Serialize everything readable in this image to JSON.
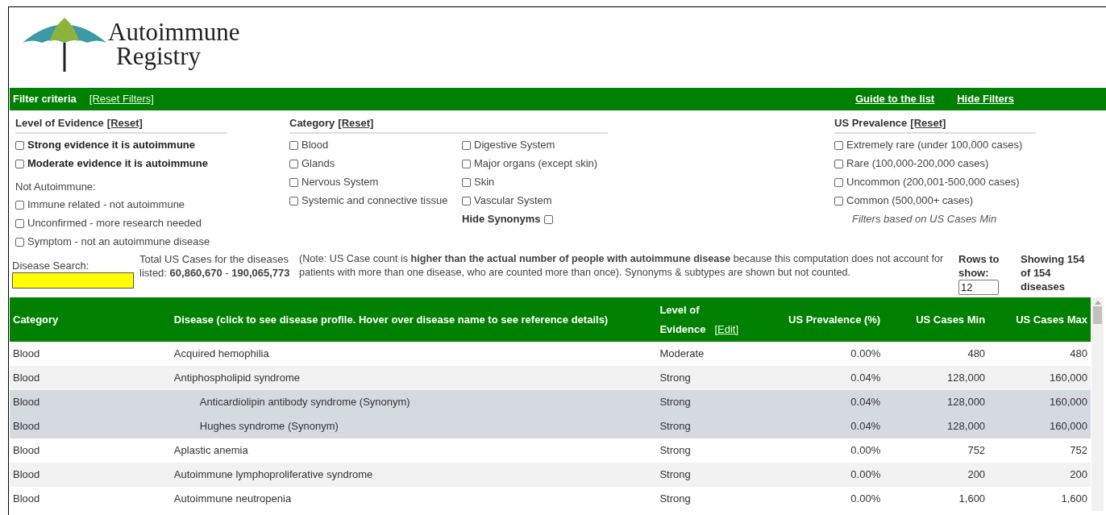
{
  "logo": {
    "lines": [
      "Autoimmune",
      "Registry"
    ]
  },
  "filter_bar": {
    "title": "Filter criteria",
    "reset": "[Reset Filters]",
    "links": [
      "Guide to the list",
      "Hide Filters"
    ]
  },
  "evidence": {
    "title": "Level of Evidence",
    "reset": "[Reset]",
    "options": [
      {
        "label": "Strong evidence it is autoimmune",
        "checked": false,
        "bold": true
      },
      {
        "label": "Moderate evidence it is autoimmune",
        "checked": false,
        "bold": true
      }
    ],
    "subheading": "Not Autoimmune:",
    "other_options": [
      {
        "label": "Immune related - not autoimmune",
        "checked": false
      },
      {
        "label": "Unconfirmed - more research needed",
        "checked": false
      },
      {
        "label": "Symptom - not an autoimmune disease",
        "checked": false
      }
    ]
  },
  "category": {
    "title": "Category",
    "reset": "[Reset]",
    "options": [
      {
        "label": "Blood",
        "checked": false
      },
      {
        "label": "Digestive System",
        "checked": false
      },
      {
        "label": "Glands",
        "checked": false
      },
      {
        "label": "Major organs (except skin)",
        "checked": false
      },
      {
        "label": "Nervous System",
        "checked": false
      },
      {
        "label": "Skin",
        "checked": false
      },
      {
        "label": "Systemic and connective tissue",
        "checked": false
      },
      {
        "label": "Vascular System",
        "checked": false
      }
    ],
    "hide_synonyms": {
      "label": "Hide Synonyms",
      "checked": false
    }
  },
  "prevalence": {
    "title": "US Prevalence",
    "reset": "[Reset]",
    "options": [
      {
        "label": "Extremely rare (under 100,000 cases)",
        "checked": false
      },
      {
        "label": "Rare (100,000-200,000 cases)",
        "checked": false
      },
      {
        "label": "Uncommon (200,001-500,000 cases)",
        "checked": false
      },
      {
        "label": "Common (500,000+ cases)",
        "checked": false
      }
    ],
    "note": "Filters based on US Cases Min"
  },
  "search": {
    "label": "Disease Search:"
  },
  "total": "Total US Cases for the diseases listed: **60,860,670** - **190,065,773**",
  "note": "(Note: US Case count is **higher than the actual number of people with autoimmune disease** because this computation does not account for patients with more than one disease, who are counted more than once). Synonyms & subtypes are shown but not counted.",
  "rows_to_show": {
    "label": "Rows to show:",
    "value": "12"
  },
  "showing": "Showing 154 of 154 diseases",
  "table": {
    "columns": [
      {
        "label": "Category"
      },
      {
        "label": "Disease (click to see disease profile. Hover over disease name to see reference details)"
      },
      {
        "label": "Level of Evidence",
        "edit": "[Edit]"
      },
      {
        "label": "US Prevalence (%)"
      },
      {
        "label": "US Cases Min"
      },
      {
        "label": "US Cases Max"
      }
    ],
    "rows": [
      {
        "cells": [
          "Blood",
          "Acquired hemophilia",
          "Moderate",
          "0.00%",
          "480",
          "480"
        ]
      },
      {
        "cells": [
          "Blood",
          "Antiphospholipid syndrome",
          "Strong",
          "0.04%",
          "128,000",
          "160,000"
        ],
        "children": [
          {
            "cells": [
              "Blood",
              "Anticardiolipin antibody syndrome (Synonym)",
              "Strong",
              "0.04%",
              "128,000",
              "160,000"
            ]
          },
          {
            "cells": [
              "Blood",
              "Hughes syndrome (Synonym)",
              "Strong",
              "0.04%",
              "128,000",
              "160,000"
            ]
          }
        ]
      },
      {
        "cells": [
          "Blood",
          "Aplastic anemia",
          "Strong",
          "0.00%",
          "752",
          "752"
        ]
      },
      {
        "cells": [
          "Blood",
          "Autoimmune lymphoproliferative syndrome",
          "Strong",
          "0.00%",
          "200",
          "200"
        ]
      },
      {
        "cells": [
          "Blood",
          "Autoimmune neutropenia",
          "Strong",
          "0.00%",
          "1,600",
          "1,600"
        ]
      }
    ]
  }
}
